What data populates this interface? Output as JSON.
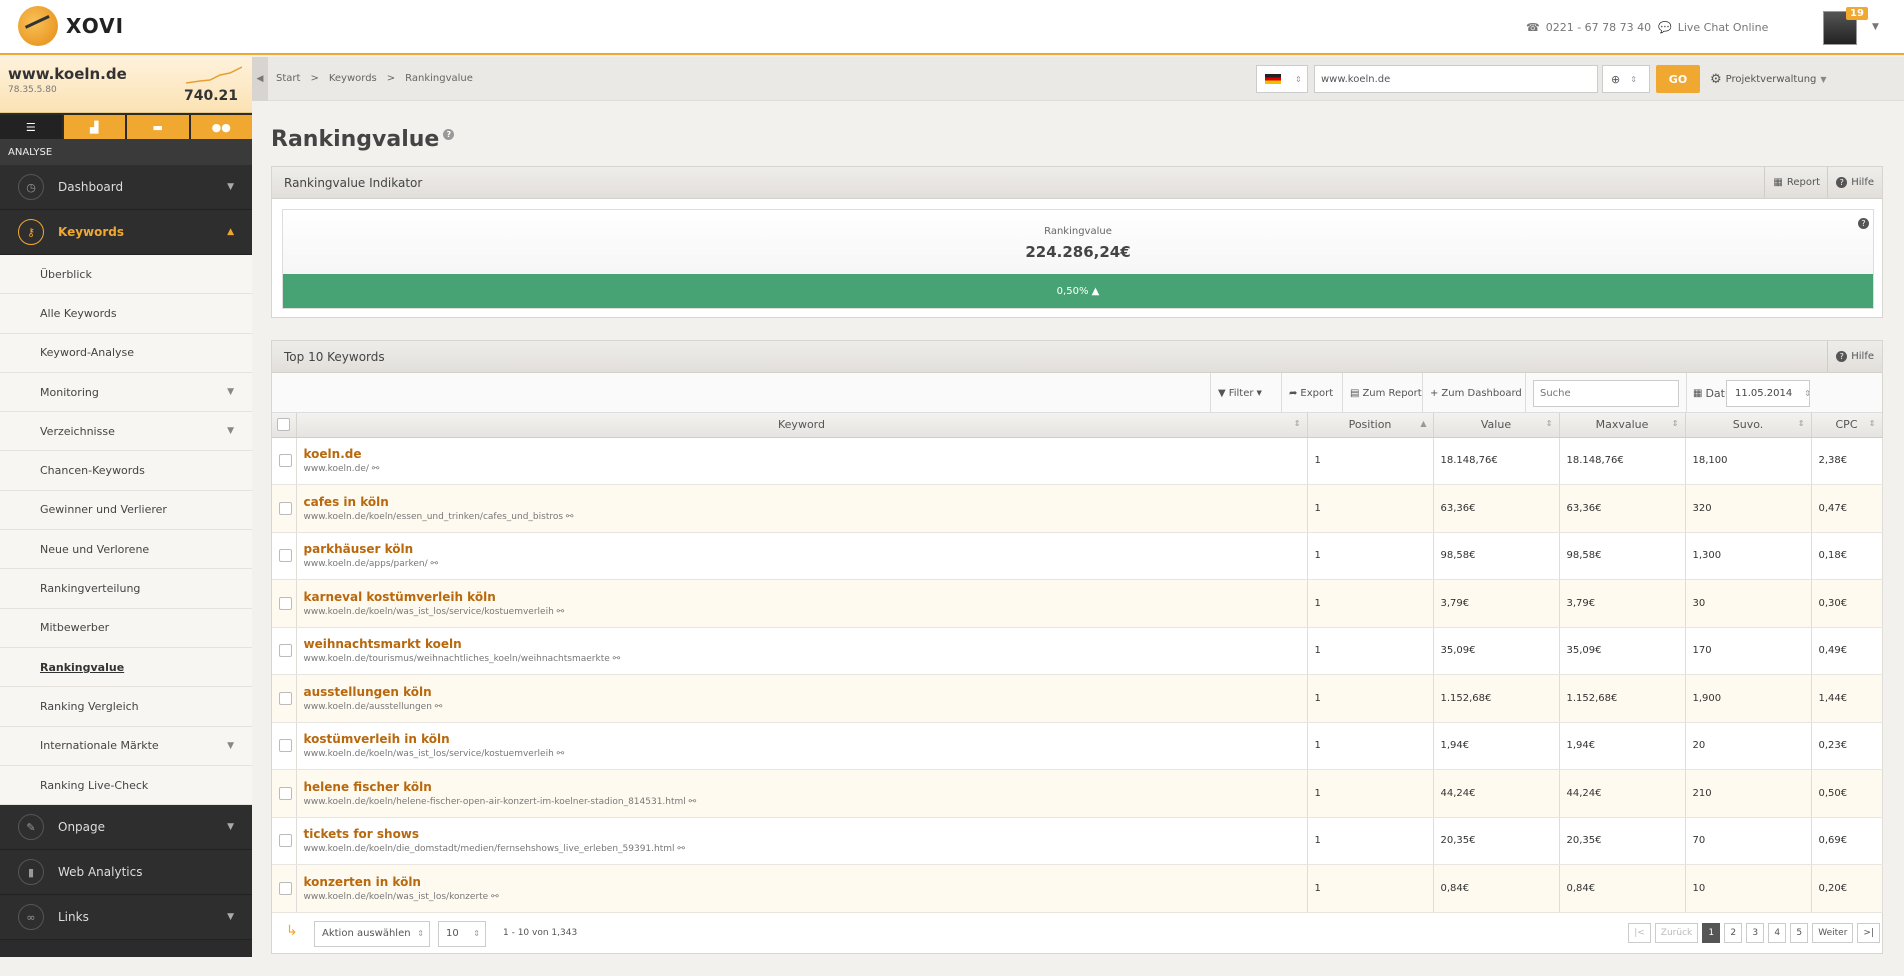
{
  "brand": {
    "name": "XOVI"
  },
  "header": {
    "phone": "0221 - 67 78 73 40",
    "chat": "Live Chat Online",
    "notifications": "19"
  },
  "site": {
    "domain": "www.koeln.de",
    "ip": "78.35.5.80",
    "value": "740.21"
  },
  "sidebar": {
    "section": "ANALYSE",
    "menu_top": [
      {
        "label": "Dashboard"
      },
      {
        "label": "Keywords"
      }
    ],
    "sub_items": [
      {
        "label": "Überblick"
      },
      {
        "label": "Alle Keywords"
      },
      {
        "label": "Keyword-Analyse"
      },
      {
        "label": "Monitoring"
      },
      {
        "label": "Verzeichnisse"
      },
      {
        "label": "Chancen-Keywords"
      },
      {
        "label": "Gewinner und Verlierer"
      },
      {
        "label": "Neue und Verlorene"
      },
      {
        "label": "Rankingverteilung"
      },
      {
        "label": "Mitbewerber"
      },
      {
        "label": "Rankingvalue"
      },
      {
        "label": "Ranking Vergleich"
      },
      {
        "label": "Internationale Märkte"
      },
      {
        "label": "Ranking Live-Check"
      }
    ],
    "menu_bottom": [
      {
        "label": "Onpage"
      },
      {
        "label": "Web Analytics"
      },
      {
        "label": "Links"
      }
    ]
  },
  "breadcrumb": [
    "Start",
    "Keywords",
    "Rankingvalue"
  ],
  "topsearch": {
    "url": "www.koeln.de",
    "go": "GO",
    "project": "Projektverwaltung"
  },
  "page": {
    "title": "Rankingvalue"
  },
  "indicator": {
    "title": "Rankingvalue Indikator",
    "report": "Report",
    "help": "Hilfe",
    "label": "Rankingvalue",
    "value": "224.286,24€",
    "change": "0,50% ▲"
  },
  "top10": {
    "title": "Top 10 Keywords",
    "help": "Hilfe",
    "toolbar": {
      "filter": "Filter",
      "export": "Export",
      "report": "Zum Report",
      "dashboard": "Zum Dashboard",
      "search_placeholder": "Suche",
      "date_label": "Datum",
      "date": "11.05.2014"
    },
    "columns": {
      "keyword": "Keyword",
      "position": "Position",
      "value": "Value",
      "maxvalue": "Maxvalue",
      "suvo": "Suvo.",
      "cpc": "CPC"
    },
    "rows": [
      {
        "kw": "koeln.de",
        "url": "www.koeln.de/",
        "pos": "1",
        "value": "18.148,76€",
        "max": "18.148,76€",
        "suvo": "18,100",
        "cpc": "2,38€"
      },
      {
        "kw": "cafes in köln",
        "url": "www.koeln.de/koeln/essen_und_trinken/cafes_und_bistros",
        "pos": "1",
        "value": "63,36€",
        "max": "63,36€",
        "suvo": "320",
        "cpc": "0,47€"
      },
      {
        "kw": "parkhäuser köln",
        "url": "www.koeln.de/apps/parken/",
        "pos": "1",
        "value": "98,58€",
        "max": "98,58€",
        "suvo": "1,300",
        "cpc": "0,18€"
      },
      {
        "kw": "karneval kostümverleih köln",
        "url": "www.koeln.de/koeln/was_ist_los/service/kostuemverleih",
        "pos": "1",
        "value": "3,79€",
        "max": "3,79€",
        "suvo": "30",
        "cpc": "0,30€"
      },
      {
        "kw": "weihnachtsmarkt koeln",
        "url": "www.koeln.de/tourismus/weihnachtliches_koeln/weihnachtsmaerkte",
        "pos": "1",
        "value": "35,09€",
        "max": "35,09€",
        "suvo": "170",
        "cpc": "0,49€"
      },
      {
        "kw": "ausstellungen köln",
        "url": "www.koeln.de/ausstellungen",
        "pos": "1",
        "value": "1.152,68€",
        "max": "1.152,68€",
        "suvo": "1,900",
        "cpc": "1,44€"
      },
      {
        "kw": "kostümverleih in köln",
        "url": "www.koeln.de/koeln/was_ist_los/service/kostuemverleih",
        "pos": "1",
        "value": "1,94€",
        "max": "1,94€",
        "suvo": "20",
        "cpc": "0,23€"
      },
      {
        "kw": "helene fischer köln",
        "url": "www.koeln.de/koeln/helene-fischer-open-air-konzert-im-koelner-stadion_814531.html",
        "pos": "1",
        "value": "44,24€",
        "max": "44,24€",
        "suvo": "210",
        "cpc": "0,50€"
      },
      {
        "kw": "tickets for shows",
        "url": "www.koeln.de/koeln/die_domstadt/medien/fernsehshows_live_erleben_59391.html",
        "pos": "1",
        "value": "20,35€",
        "max": "20,35€",
        "suvo": "70",
        "cpc": "0,69€"
      },
      {
        "kw": "konzerten in köln",
        "url": "www.koeln.de/koeln/was_ist_los/konzerte",
        "pos": "1",
        "value": "0,84€",
        "max": "0,84€",
        "suvo": "10",
        "cpc": "0,20€"
      }
    ],
    "footer": {
      "action": "Aktion auswählen",
      "per_page": "10",
      "range": "1 - 10 von 1,343",
      "first": "|<",
      "prev": "Zurück",
      "pages": [
        "1",
        "2",
        "3",
        "4",
        "5"
      ],
      "next": "Weiter",
      "last": ">|"
    }
  },
  "colors": {
    "accent": "#f0a830",
    "positive": "#47a374",
    "link": "#b8680d"
  }
}
